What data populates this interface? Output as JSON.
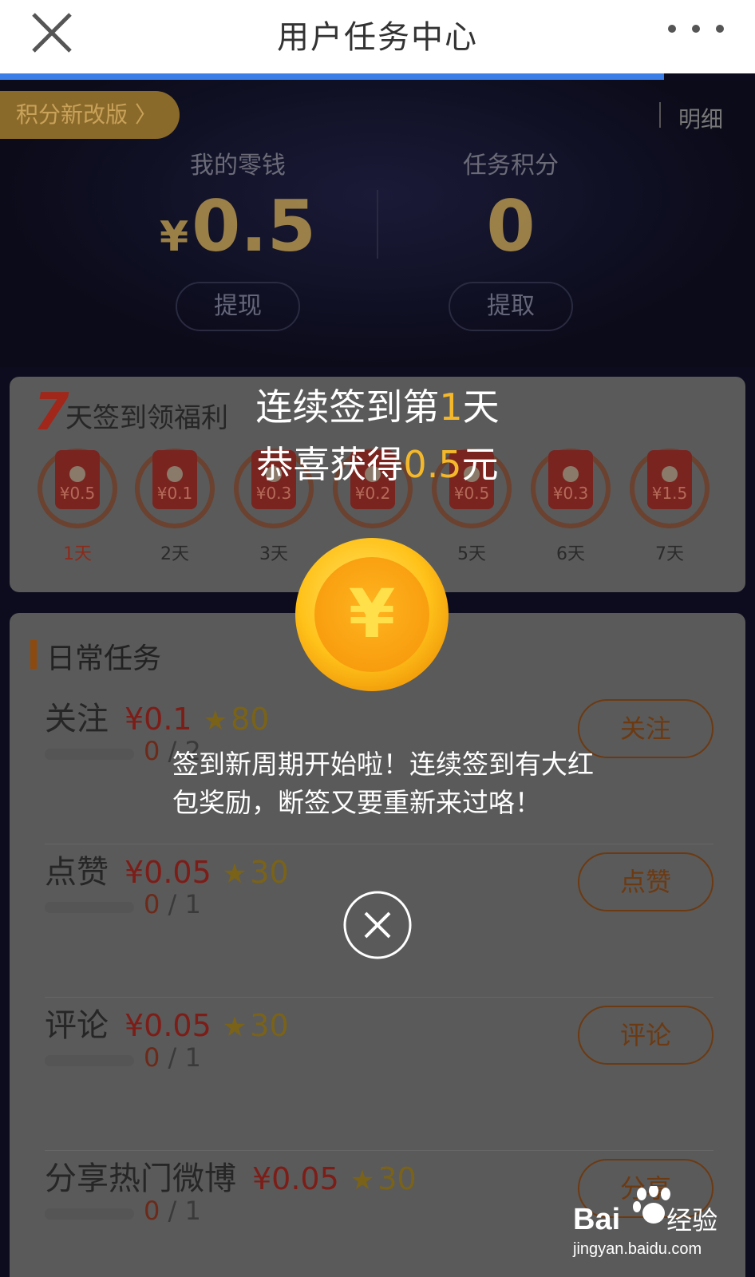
{
  "appbar": {
    "title": "用户任务中心",
    "progress_fraction": 0.88
  },
  "header": {
    "promo_label": "积分新改版 〉",
    "detail_label": "明细",
    "wallet": {
      "label": "我的零钱",
      "currency": "¥",
      "value": "0.5",
      "button": "提现"
    },
    "points": {
      "label": "任务积分",
      "value": "0",
      "button": "提取"
    }
  },
  "checkin": {
    "seven": "7",
    "title": "天签到领福利",
    "days": [
      {
        "amount": "¥0.5",
        "label": "1天"
      },
      {
        "amount": "¥0.1",
        "label": "2天"
      },
      {
        "amount": "¥0.3",
        "label": "3天"
      },
      {
        "amount": "¥0.2",
        "label": ""
      },
      {
        "amount": "¥0.5",
        "label": "5天"
      },
      {
        "amount": "¥0.3",
        "label": "6天"
      },
      {
        "amount": "¥1.5",
        "label": "7天"
      }
    ]
  },
  "tasks": {
    "title": "日常任务",
    "items": [
      {
        "name": "关注",
        "money": "¥0.1",
        "points": "80",
        "done": "0",
        "total": "2",
        "button": "关注"
      },
      {
        "name": "点赞",
        "money": "¥0.05",
        "points": "30",
        "done": "0",
        "total": "1",
        "button": "点赞"
      },
      {
        "name": "评论",
        "money": "¥0.05",
        "points": "30",
        "done": "0",
        "total": "1",
        "button": "评论"
      },
      {
        "name": "分享热门微博",
        "money": "¥0.05",
        "points": "30",
        "done": "0",
        "total": "1",
        "button": "分享"
      }
    ]
  },
  "popup": {
    "line1_prefix": "连续签到第",
    "line1_day": "1",
    "line1_suffix": "天",
    "line2_prefix": "恭喜获得",
    "line2_amount": "0.5",
    "line2_suffix": "元",
    "message": "签到新周期开始啦！连续签到有大红包奖励，断签又要重新来过咯！",
    "coin_symbol": "¥"
  },
  "watermark": {
    "brand": "Bai",
    "brand_cn": "经验",
    "url": "jingyan.baidu.com"
  },
  "colors": {
    "accent_blue": "#3b7ee8",
    "gold": "#f5b82a",
    "red": "#d8332a"
  }
}
